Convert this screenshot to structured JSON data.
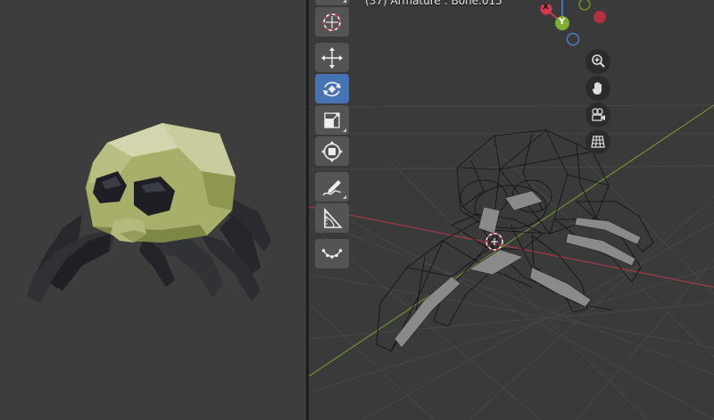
{
  "viewport_right": {
    "header_text": "(37) Armature : Bone.015"
  },
  "gizmo": {
    "x_label": "X",
    "y_label": "Y"
  },
  "toolbar": {
    "tools": [
      {
        "name": "cursor-tool",
        "icon": "cursor-icon"
      },
      {
        "name": "move-tool",
        "icon": "move-icon"
      },
      {
        "name": "rotate-tool",
        "icon": "rotate-icon",
        "active": true
      },
      {
        "name": "scale-tool",
        "icon": "scale-icon"
      },
      {
        "name": "transform-tool",
        "icon": "transform-icon"
      },
      {
        "name": "annotate-tool",
        "icon": "annotate-icon"
      },
      {
        "name": "measure-tool",
        "icon": "measure-icon"
      },
      {
        "name": "bone-roll-tool",
        "icon": "bone-roll-icon"
      }
    ]
  },
  "navigation": {
    "buttons": [
      "zoom-icon",
      "hand-pan-icon",
      "camera-icon",
      "grid-icon"
    ]
  },
  "colors": {
    "active_tool": "#4772b3",
    "axis_x": "#d1384d",
    "axis_y": "#7fae32",
    "axis_z": "#4a82c6",
    "body": "#a5ad68"
  }
}
